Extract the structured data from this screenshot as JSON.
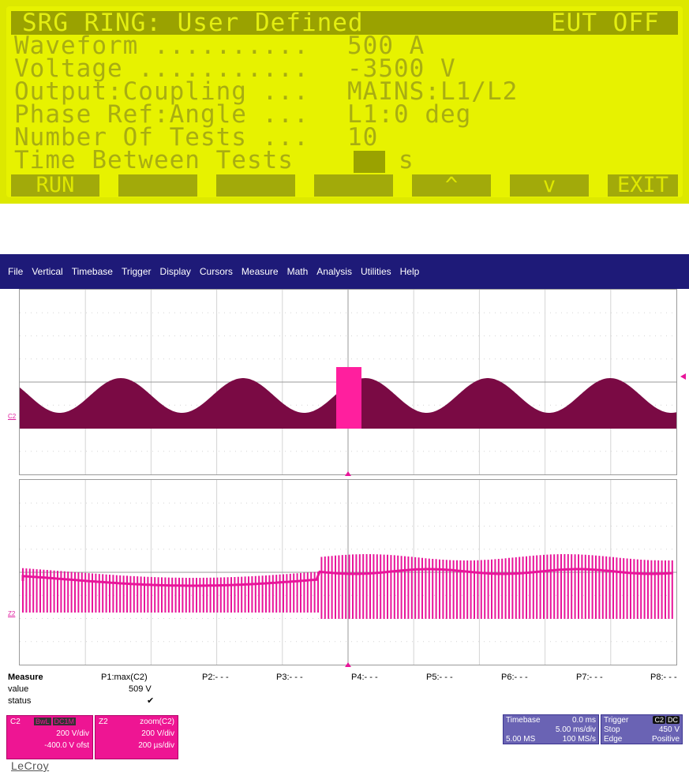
{
  "lcd": {
    "title": "SRG RING: User Defined",
    "status": "EUT OFF",
    "rows": [
      {
        "label": "Waveform ..........",
        "value": "500 A"
      },
      {
        "label": "Voltage ...........",
        "value": "-3500 V"
      },
      {
        "label": "Output:Coupling ...",
        "value": "MAINS:L1/L2"
      },
      {
        "label": "Phase Ref:Angle ...",
        "value": "L1:0 deg"
      },
      {
        "label": "Number Of Tests ...",
        "value": "10"
      },
      {
        "label": "Time Between Tests",
        "value": "s"
      }
    ],
    "softkeys": {
      "run": "RUN",
      "up": "^",
      "down": "v",
      "exit": "EXIT"
    }
  },
  "scope": {
    "menu": [
      "File",
      "Vertical",
      "Timebase",
      "Trigger",
      "Display",
      "Cursors",
      "Measure",
      "Math",
      "Analysis",
      "Utilities",
      "Help"
    ],
    "channel_labels": {
      "upper": "C2",
      "lower": "Z2"
    },
    "measure": {
      "header": "Measure",
      "row_value": "value",
      "row_status": "status",
      "params": [
        "P1:max(C2)",
        "P2:- - -",
        "P3:- - -",
        "P4:- - -",
        "P5:- - -",
        "P6:- - -",
        "P7:- - -",
        "P8:- - -"
      ],
      "p1_value": "509 V",
      "p1_status": "✔"
    },
    "c2": {
      "name": "C2",
      "badge1": "BwL",
      "badge2": "DC1M",
      "vdiv": "200 V/div",
      "offset": "-400.0 V ofst"
    },
    "z2": {
      "name": "Z2",
      "source": "zoom(C2)",
      "vdiv": "200 V/div",
      "tdiv": "200 µs/div"
    },
    "timebase": {
      "label": "Timebase",
      "delay": "0.0 ms",
      "tdiv": "5.00 ms/div",
      "samples": "5.00 MS",
      "rate": "100 MS/s"
    },
    "trigger": {
      "label": "Trigger",
      "badge1": "C2",
      "badge2": "DC",
      "mode": "Stop",
      "level": "450 V",
      "type": "Edge",
      "slope": "Positive"
    },
    "brand": "LeCroy",
    "colors": {
      "menubar": "#1e1a78",
      "trace_upper": "#7a0a44",
      "trace_highlight": "#ff1f9e",
      "trace_lower": "#e8159a",
      "chip_pink": "#ee1593",
      "chip_purple": "#6a63b4"
    }
  }
}
